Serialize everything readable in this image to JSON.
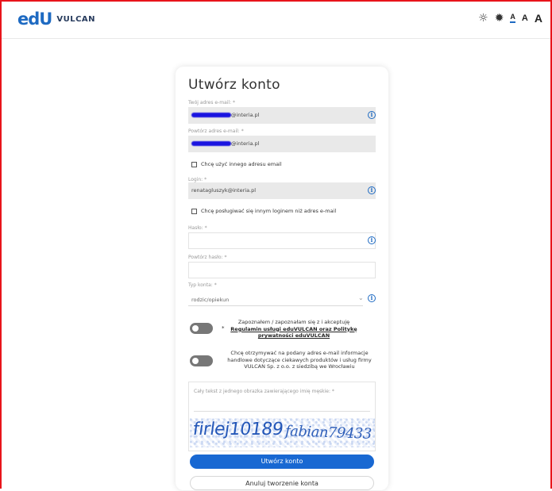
{
  "header": {
    "logo_mark_e": "e",
    "logo_mark_d": "d",
    "logo_mark_u": "U",
    "logo_text": "VULCAN",
    "tools": {
      "contrast_icon": "sun-outline-icon",
      "contrast_alt_icon": "sun-filled-icon",
      "font_small": "A",
      "font_medium": "A",
      "font_large": "A"
    }
  },
  "form": {
    "title": "Utwórz konto",
    "email_label": "Twój adres e-mail: *",
    "email_value": "@interia.pl",
    "email_repeat_label": "Powtórz adres e-mail: *",
    "email_repeat_value": "@interia.pl",
    "other_email_checkbox": "Chcę użyć innego adresu email",
    "login_label": "Login: *",
    "login_value": "renatagluszyk@interia.pl",
    "other_login_checkbox": "Chcę posługiwać się innym loginem niż adres e-mail",
    "password_label": "Hasło: *",
    "password_repeat_label": "Powtórz hasło: *",
    "account_type_label": "Typ konta: *",
    "account_type_value": "rodzic/opiekun",
    "consent_required_star": "*",
    "consent_required_text": "Zapoznałem / zapoznałam się z i akceptuję",
    "consent_required_link": "Regulamin usługi eduVULCAN oraz Politykę prywatności eduVULCAN",
    "consent_marketing_text": "Chcę otrzymywać na podany adres e-mail informacje handlowe dotyczące ciekawych produktów i usług firmy VULCAN Sp. z o.o. z siedzibą we Wrocławiu",
    "captcha_label": "Cały tekst z jednego obrazka zawierającego imię męskie: *",
    "captcha_word_1": "firlej10189",
    "captcha_word_2": "fabian79433",
    "submit_label": "Utwórz konto",
    "cancel_label": "Anuluj tworzenie konta",
    "info_glyph": "i"
  },
  "colors": {
    "accent": "#1868d2",
    "border_red": "#e8141b",
    "field_gray": "#e9e9e9"
  }
}
